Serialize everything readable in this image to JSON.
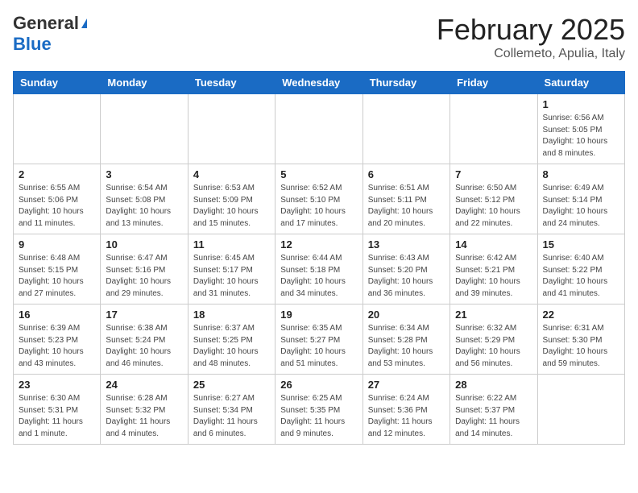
{
  "header": {
    "logo_general": "General",
    "logo_blue": "Blue",
    "month_title": "February 2025",
    "location": "Collemeto, Apulia, Italy"
  },
  "days_of_week": [
    "Sunday",
    "Monday",
    "Tuesday",
    "Wednesday",
    "Thursday",
    "Friday",
    "Saturday"
  ],
  "weeks": [
    [
      {
        "day": "",
        "info": ""
      },
      {
        "day": "",
        "info": ""
      },
      {
        "day": "",
        "info": ""
      },
      {
        "day": "",
        "info": ""
      },
      {
        "day": "",
        "info": ""
      },
      {
        "day": "",
        "info": ""
      },
      {
        "day": "1",
        "info": "Sunrise: 6:56 AM\nSunset: 5:05 PM\nDaylight: 10 hours and 8 minutes."
      }
    ],
    [
      {
        "day": "2",
        "info": "Sunrise: 6:55 AM\nSunset: 5:06 PM\nDaylight: 10 hours and 11 minutes."
      },
      {
        "day": "3",
        "info": "Sunrise: 6:54 AM\nSunset: 5:08 PM\nDaylight: 10 hours and 13 minutes."
      },
      {
        "day": "4",
        "info": "Sunrise: 6:53 AM\nSunset: 5:09 PM\nDaylight: 10 hours and 15 minutes."
      },
      {
        "day": "5",
        "info": "Sunrise: 6:52 AM\nSunset: 5:10 PM\nDaylight: 10 hours and 17 minutes."
      },
      {
        "day": "6",
        "info": "Sunrise: 6:51 AM\nSunset: 5:11 PM\nDaylight: 10 hours and 20 minutes."
      },
      {
        "day": "7",
        "info": "Sunrise: 6:50 AM\nSunset: 5:12 PM\nDaylight: 10 hours and 22 minutes."
      },
      {
        "day": "8",
        "info": "Sunrise: 6:49 AM\nSunset: 5:14 PM\nDaylight: 10 hours and 24 minutes."
      }
    ],
    [
      {
        "day": "9",
        "info": "Sunrise: 6:48 AM\nSunset: 5:15 PM\nDaylight: 10 hours and 27 minutes."
      },
      {
        "day": "10",
        "info": "Sunrise: 6:47 AM\nSunset: 5:16 PM\nDaylight: 10 hours and 29 minutes."
      },
      {
        "day": "11",
        "info": "Sunrise: 6:45 AM\nSunset: 5:17 PM\nDaylight: 10 hours and 31 minutes."
      },
      {
        "day": "12",
        "info": "Sunrise: 6:44 AM\nSunset: 5:18 PM\nDaylight: 10 hours and 34 minutes."
      },
      {
        "day": "13",
        "info": "Sunrise: 6:43 AM\nSunset: 5:20 PM\nDaylight: 10 hours and 36 minutes."
      },
      {
        "day": "14",
        "info": "Sunrise: 6:42 AM\nSunset: 5:21 PM\nDaylight: 10 hours and 39 minutes."
      },
      {
        "day": "15",
        "info": "Sunrise: 6:40 AM\nSunset: 5:22 PM\nDaylight: 10 hours and 41 minutes."
      }
    ],
    [
      {
        "day": "16",
        "info": "Sunrise: 6:39 AM\nSunset: 5:23 PM\nDaylight: 10 hours and 43 minutes."
      },
      {
        "day": "17",
        "info": "Sunrise: 6:38 AM\nSunset: 5:24 PM\nDaylight: 10 hours and 46 minutes."
      },
      {
        "day": "18",
        "info": "Sunrise: 6:37 AM\nSunset: 5:25 PM\nDaylight: 10 hours and 48 minutes."
      },
      {
        "day": "19",
        "info": "Sunrise: 6:35 AM\nSunset: 5:27 PM\nDaylight: 10 hours and 51 minutes."
      },
      {
        "day": "20",
        "info": "Sunrise: 6:34 AM\nSunset: 5:28 PM\nDaylight: 10 hours and 53 minutes."
      },
      {
        "day": "21",
        "info": "Sunrise: 6:32 AM\nSunset: 5:29 PM\nDaylight: 10 hours and 56 minutes."
      },
      {
        "day": "22",
        "info": "Sunrise: 6:31 AM\nSunset: 5:30 PM\nDaylight: 10 hours and 59 minutes."
      }
    ],
    [
      {
        "day": "23",
        "info": "Sunrise: 6:30 AM\nSunset: 5:31 PM\nDaylight: 11 hours and 1 minute."
      },
      {
        "day": "24",
        "info": "Sunrise: 6:28 AM\nSunset: 5:32 PM\nDaylight: 11 hours and 4 minutes."
      },
      {
        "day": "25",
        "info": "Sunrise: 6:27 AM\nSunset: 5:34 PM\nDaylight: 11 hours and 6 minutes."
      },
      {
        "day": "26",
        "info": "Sunrise: 6:25 AM\nSunset: 5:35 PM\nDaylight: 11 hours and 9 minutes."
      },
      {
        "day": "27",
        "info": "Sunrise: 6:24 AM\nSunset: 5:36 PM\nDaylight: 11 hours and 12 minutes."
      },
      {
        "day": "28",
        "info": "Sunrise: 6:22 AM\nSunset: 5:37 PM\nDaylight: 11 hours and 14 minutes."
      },
      {
        "day": "",
        "info": ""
      }
    ]
  ]
}
